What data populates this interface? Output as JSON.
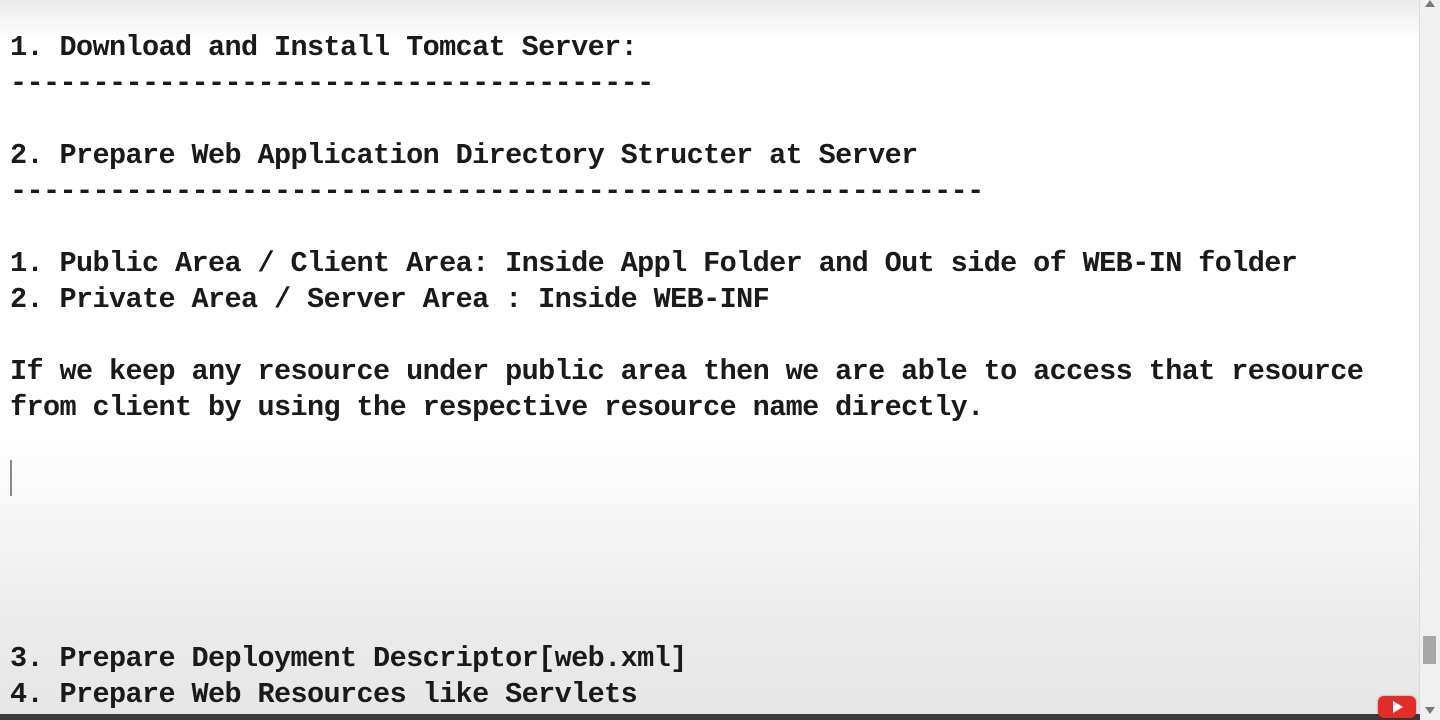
{
  "editor": {
    "lines": [
      "1. Download and Install Tomcat Server:",
      "---------------------------------------",
      "2. Prepare Web Application Directory Structer at Server",
      "-----------------------------------------------------------",
      "1. Public Area / Client Area: Inside Appl Folder and Out side of WEB-IN folder",
      "2. Private Area / Server Area : Inside WEB-INF",
      "If we keep any resource under public area then we are able to access that resource",
      "from client by using the respective resource name directly.",
      "3. Prepare Deployment Descriptor[web.xml]",
      "4. Prepare Web Resources like Servlets"
    ]
  },
  "icons": {
    "scroll_up": "chevron-up-icon",
    "scroll_down": "chevron-down-icon",
    "watermark": "youtube-logo-icon"
  },
  "colors": {
    "text": "#1a1a1a",
    "background": "#ffffff",
    "youtube_red": "#e52d27"
  }
}
